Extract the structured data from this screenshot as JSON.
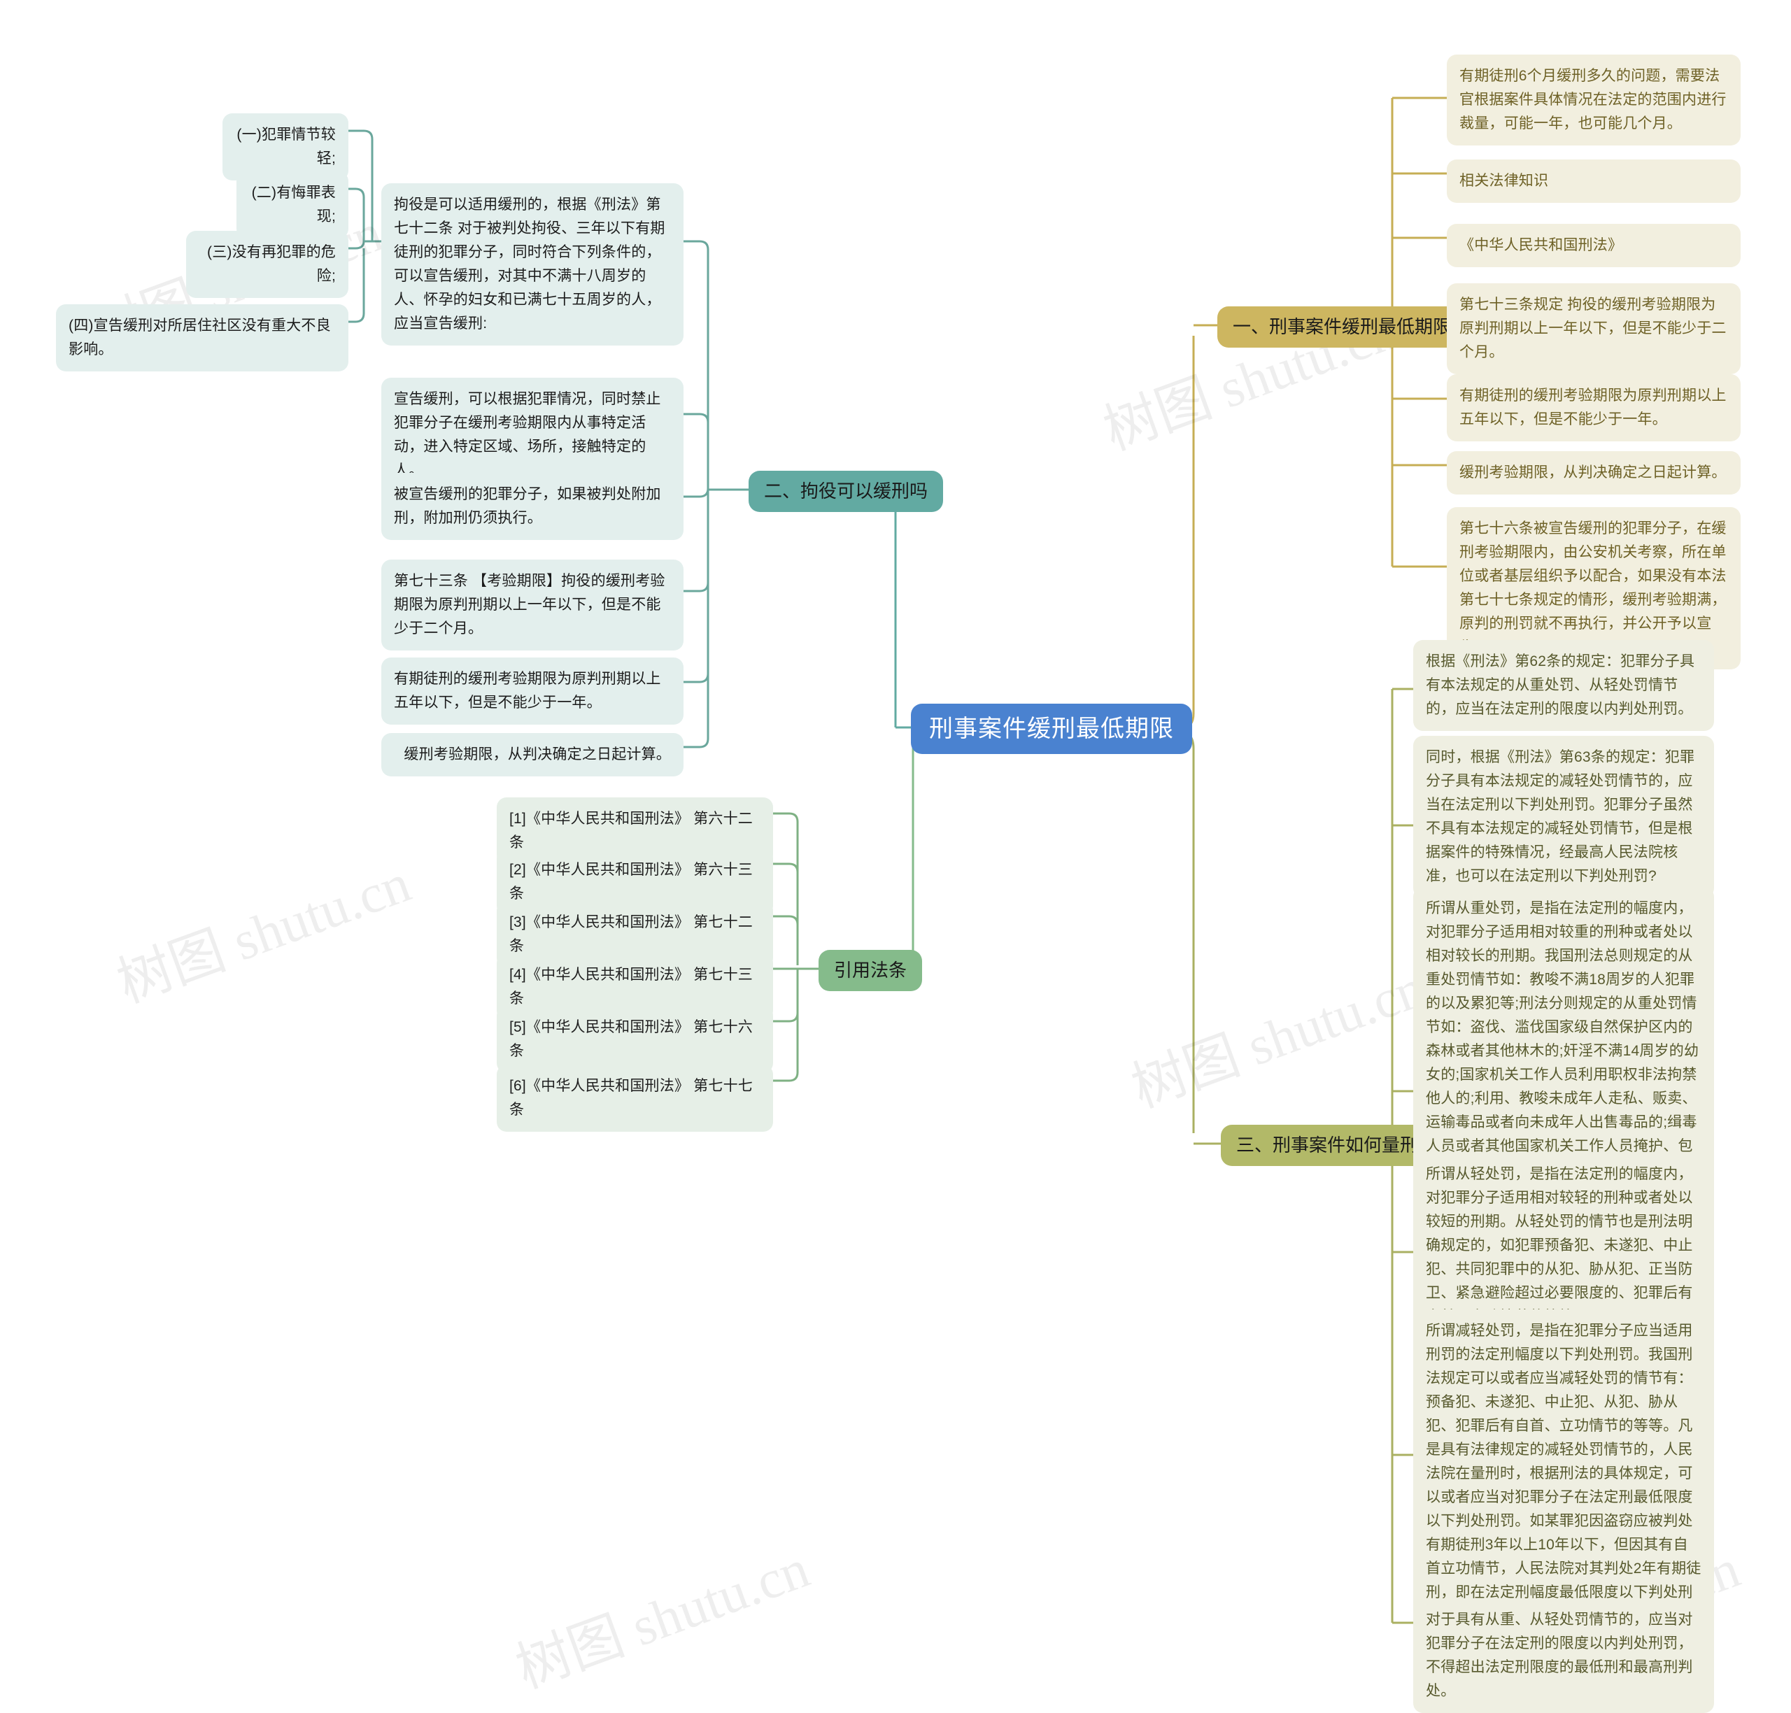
{
  "root": {
    "label": "刑事案件缓刑最低期限",
    "color": "#4a82d0"
  },
  "watermark": {
    "text": "树图 shutu.cn"
  },
  "branches": {
    "b1": {
      "label": "一、刑事案件缓刑最低期限",
      "color": "#cdb660"
    },
    "b2": {
      "label": "二、拘役可以缓刑吗",
      "color": "#62aaa2"
    },
    "b3": {
      "label": "三、刑事案件如何量刑",
      "color": "#b2b968"
    },
    "b4": {
      "label": "引用法条",
      "color": "#85bb8b"
    }
  },
  "left_conditions": [
    {
      "text": "(一)犯罪情节较轻;"
    },
    {
      "text": "(二)有悔罪表现;"
    },
    {
      "text": "(三)没有再犯罪的危险;"
    },
    {
      "text": "(四)宣告缓刑对所居住社区没有重大不良影响。"
    }
  ],
  "branch2_nodes": [
    {
      "text": "拘役是可以适用缓刑的，根据《刑法》第七十二条 对于被判处拘役、三年以下有期徒刑的犯罪分子，同时符合下列条件的，可以宣告缓刑，对其中不满十八周岁的人、怀孕的妇女和已满七十五周岁的人，应当宣告缓刑:"
    },
    {
      "text": "宣告缓刑，可以根据犯罪情况，同时禁止犯罪分子在缓刑考验期限内从事特定活动，进入特定区域、场所，接触特定的人。"
    },
    {
      "text": "被宣告缓刑的犯罪分子，如果被判处附加刑，附加刑仍须执行。"
    },
    {
      "text": "第七十三条 【考验期限】拘役的缓刑考验期限为原判刑期以上一年以下，但是不能少于二个月。"
    },
    {
      "text": "有期徒刑的缓刑考验期限为原判刑期以上五年以下，但是不能少于一年。"
    },
    {
      "text": "缓刑考验期限，从判决确定之日起计算。"
    }
  ],
  "citations": [
    {
      "text": "[1]《中华人民共和国刑法》 第六十二条"
    },
    {
      "text": "[2]《中华人民共和国刑法》 第六十三条"
    },
    {
      "text": "[3]《中华人民共和国刑法》 第七十二条"
    },
    {
      "text": "[4]《中华人民共和国刑法》 第七十三条"
    },
    {
      "text": "[5]《中华人民共和国刑法》 第七十六条"
    },
    {
      "text": "[6]《中华人民共和国刑法》 第七十七条"
    }
  ],
  "branch1_nodes": [
    {
      "text": "有期徒刑6个月缓刑多久的问题，需要法官根据案件具体情况在法定的范围内进行裁量，可能一年，也可能几个月。"
    },
    {
      "text": "相关法律知识"
    },
    {
      "text": "《中华人民共和国刑法》"
    },
    {
      "text": "第七十三条规定 拘役的缓刑考验期限为原判刑期以上一年以下，但是不能少于二个月。"
    },
    {
      "text": "有期徒刑的缓刑考验期限为原判刑期以上五年以下，但是不能少于一年。"
    },
    {
      "text": "缓刑考验期限，从判决确定之日起计算。"
    },
    {
      "text": "第七十六条被宣告缓刑的犯罪分子，在缓刑考验期限内，由公安机关考察，所在单位或者基层组织予以配合，如果没有本法第七十七条规定的情形，缓刑考验期满，原判的刑罚就不再执行，并公开予以宣告。"
    }
  ],
  "branch3_nodes": [
    {
      "text": "根据《刑法》第62条的规定：犯罪分子具有本法规定的从重处罚、从轻处罚情节的，应当在法定刑的限度以内判处刑罚。"
    },
    {
      "text": "同时，根据《刑法》第63条的规定：犯罪分子具有本法规定的减轻处罚情节的，应当在法定刑以下判处刑罚。犯罪分子虽然不具有本法规定的减轻处罚情节，但是根据案件的特殊情况，经最高人民法院核准，也可以在法定刑以下判处刑罚?"
    },
    {
      "text": "所谓从重处罚，是指在法定刑的幅度内，对犯罪分子适用相对较重的刑种或者处以相对较长的刑期。我国刑法总则规定的从重处罚情节如：教唆不满18周岁的人犯罪的以及累犯等;刑法分则规定的从重处罚情节如：盗伐、滥伐国家级自然保护区内的森林或者其他林木的;奸淫不满14周岁的幼女的;国家机关工作人员利用职权非法拘禁他人的;利用、教唆未成年人走私、贩卖、运输毒品或者向未成年人出售毒品的;缉毒人员或者其他国家机关工作人员掩护、包庇走私、贩卖、运输、制造毒品的犯罪分子等等。总之，从重处罚的情节是法律明确规定的。"
    },
    {
      "text": "所谓从轻处罚，是指在法定刑的幅度内，对犯罪分子适用相对较轻的刑种或者处以较短的刑期。从轻处罚的情节也是刑法明确规定的，如犯罪预备犯、未遂犯、中止犯、共同犯罪中的从犯、胁从犯、正当防卫、紧急避险超过必要限度的、犯罪后有自首、立功情节的等等。"
    },
    {
      "text": "所谓减轻处罚，是指在犯罪分子应当适用刑罚的法定刑幅度以下判处刑罚。我国刑法规定可以或者应当减轻处罚的情节有：预备犯、未遂犯、中止犯、从犯、胁从犯、犯罪后有自首、立功情节的等等。凡是具有法律规定的减轻处罚情节的，人民法院在量刑时，根据刑法的具体规定，可以或者应当对犯罪分子在法定刑最低限度以下判处刑罚。如某罪犯因盗窃应被判处有期徒刑3年以上10年以下，但因其有自首立功情节，人民法院对其判处2年有期徒刑，即在法定刑幅度最低限度以下判处刑罚。"
    },
    {
      "text": "对于具有从重、从轻处罚情节的，应当对犯罪分子在法定刑的限度以内判处刑罚，不得超出法定刑限度的最低刑和最高刑判处。"
    }
  ]
}
